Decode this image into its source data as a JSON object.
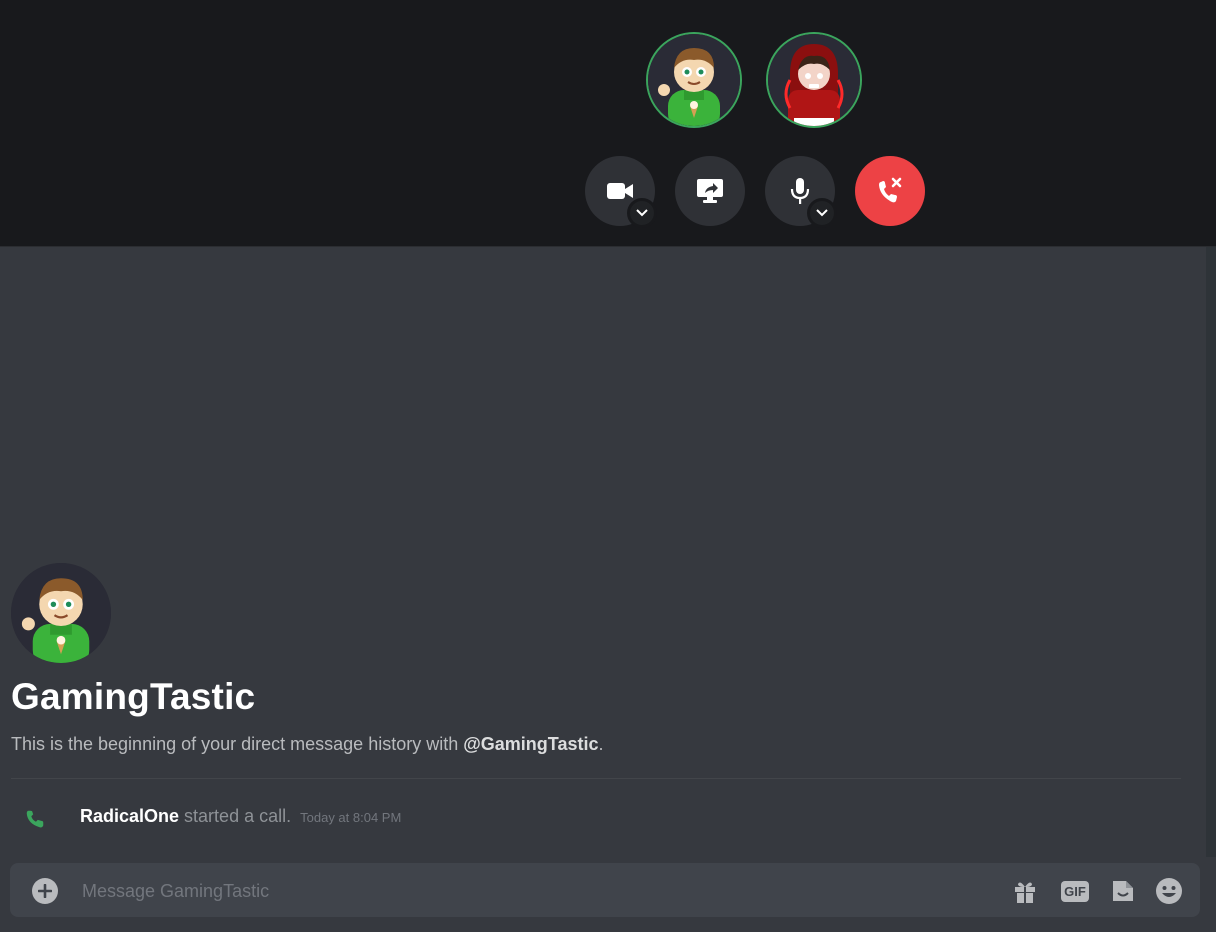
{
  "call": {
    "participants": [
      {
        "name": "GamingTastic",
        "avatar": "green-hoodie-character",
        "ring_color": "#3ba55d"
      },
      {
        "name": "RadicalOne",
        "avatar": "red-hoodie-character",
        "ring_color": "#3ba55d"
      }
    ],
    "controls": [
      {
        "icon": "video-camera-icon",
        "has_dropdown": true
      },
      {
        "icon": "screen-share-icon",
        "has_dropdown": false
      },
      {
        "icon": "microphone-icon",
        "has_dropdown": true
      },
      {
        "icon": "hang-up-icon",
        "has_dropdown": false,
        "color": "#ed4245"
      }
    ]
  },
  "intro": {
    "title": "GamingTastic",
    "description_prefix": "This is the beginning of your direct message history with ",
    "mention": "@GamingTastic",
    "description_suffix": "."
  },
  "messages": [
    {
      "type": "call-started",
      "icon": "phone-icon",
      "user": "RadicalOne",
      "text": " started a call.",
      "timestamp": "Today at 8:04 PM"
    }
  ],
  "composer": {
    "placeholder": "Message GamingTastic",
    "tools": [
      "gift-icon",
      "gif-icon",
      "sticker-icon",
      "emoji-icon"
    ],
    "gif_label": "GIF"
  },
  "colors": {
    "call_bg": "#18191c",
    "chat_bg": "#36393f",
    "hangup": "#ed4245",
    "speaking_ring": "#3ba55d"
  }
}
